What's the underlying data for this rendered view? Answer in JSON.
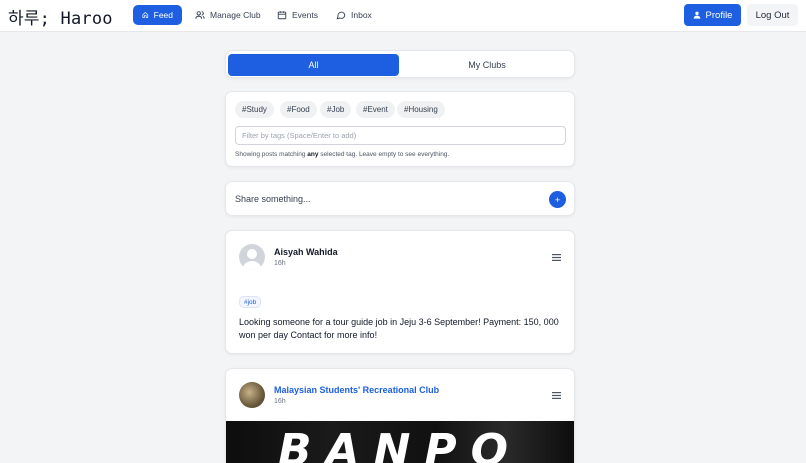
{
  "navbar": {
    "brand": "하루; Haroo",
    "items": [
      {
        "label": "Feed",
        "icon": "home-icon",
        "active": true
      },
      {
        "label": "Manage Club",
        "icon": "users-icon",
        "active": false
      },
      {
        "label": "Events",
        "icon": "calendar-icon",
        "active": false
      },
      {
        "label": "Inbox",
        "icon": "chat-icon",
        "active": false
      }
    ],
    "profile_label": "Profile",
    "logout_label": "Log Out"
  },
  "tabs": [
    {
      "label": "All",
      "active": true
    },
    {
      "label": "My Clubs",
      "active": false
    }
  ],
  "filter": {
    "tags": [
      "#Study",
      "#Food",
      "#Job",
      "#Event",
      "#Housing"
    ],
    "placeholder": "Filter by tags (Space/Enter to add)",
    "hint_prefix": "Showing posts matching ",
    "hint_bold": "any",
    "hint_suffix": " selected tag. Leave empty to see everything."
  },
  "composer": {
    "placeholder": "Share something...",
    "button": "+"
  },
  "posts": [
    {
      "author": "Aisyah Wahida",
      "time": "16h",
      "tag": "#job",
      "body": "Looking someone for a tour guide job in Jeju 3-6 September! Payment: 150, 000 won per day Contact for more info!"
    },
    {
      "author": "Malaysian Students' Recreational Club",
      "time": "16h",
      "image_text": "BANPO"
    }
  ],
  "colors": {
    "accent": "#1d5fe0",
    "page_bg": "#f3f4f6"
  }
}
